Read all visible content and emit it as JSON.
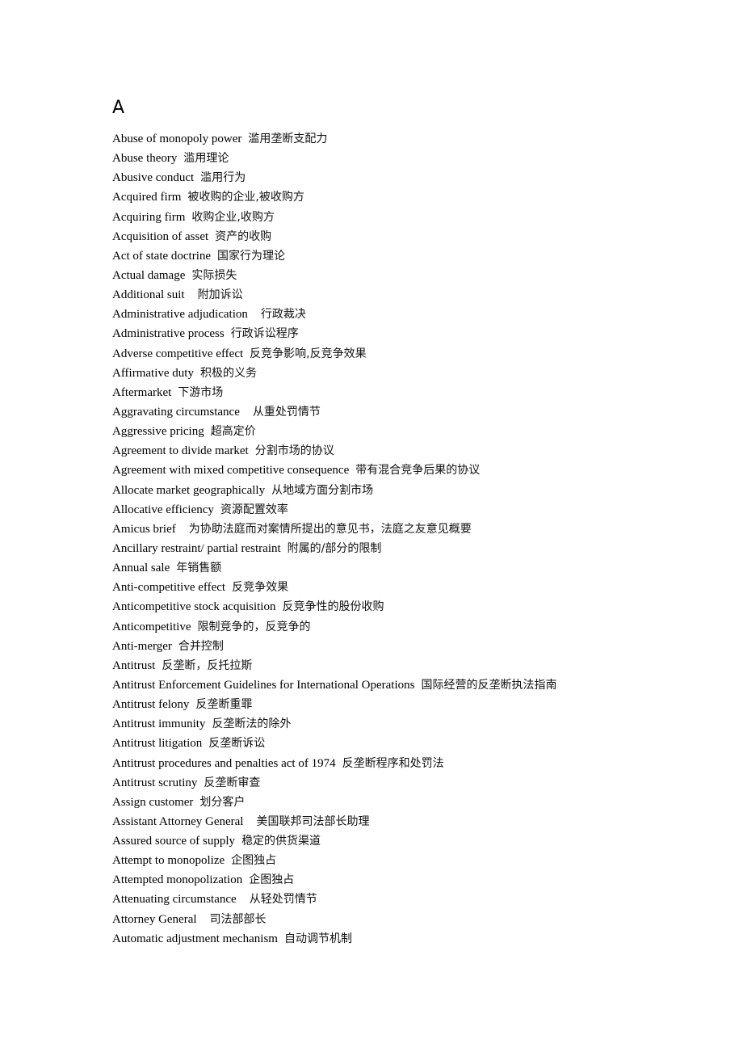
{
  "section_letter": "A",
  "entries": [
    {
      "term": "Abuse of monopoly power",
      "translation": "滥用垄断支配力"
    },
    {
      "term": "Abuse theory",
      "translation": "滥用理论"
    },
    {
      "term": "Abusive conduct",
      "translation": "滥用行为"
    },
    {
      "term": "Acquired firm",
      "translation": "被收购的企业,被收购方"
    },
    {
      "term": "Acquiring firm",
      "translation": "收购企业,收购方"
    },
    {
      "term": "Acquisition of asset",
      "translation": "资产的收购"
    },
    {
      "term": "Act of state doctrine",
      "translation": "国家行为理论"
    },
    {
      "term": "Actual damage",
      "translation": "实际损失"
    },
    {
      "term": "Additional suit",
      "translation": "附加诉讼",
      "wide": true
    },
    {
      "term": "Administrative adjudication",
      "translation": "行政裁决",
      "wide": true
    },
    {
      "term": "Administrative process",
      "translation": "行政诉讼程序"
    },
    {
      "term": "Adverse competitive effect",
      "translation": "反竞争影响,反竞争效果"
    },
    {
      "term": "Affirmative duty",
      "translation": "积极的义务"
    },
    {
      "term": "Aftermarket",
      "translation": "下游市场"
    },
    {
      "term": "Aggravating circumstance",
      "translation": "从重处罚情节",
      "wide": true
    },
    {
      "term": "Aggressive pricing",
      "translation": "超高定价"
    },
    {
      "term": "Agreement to divide market",
      "translation": "分割市场的协议"
    },
    {
      "term": "Agreement with mixed competitive consequence",
      "translation": "带有混合竞争后果的协议"
    },
    {
      "term": "Allocate market geographically",
      "translation": "从地域方面分割市场"
    },
    {
      "term": "Allocative efficiency",
      "translation": "资源配置效率"
    },
    {
      "term": "Amicus brief",
      "translation": "为协助法庭而对案情所提出的意见书，法庭之友意见概要",
      "wide": true
    },
    {
      "term": "Ancillary restraint/ partial restraint",
      "translation": "附属的/部分的限制"
    },
    {
      "term": "Annual sale",
      "translation": "年销售额"
    },
    {
      "term": "Anti-competitive effect",
      "translation": "反竞争效果"
    },
    {
      "term": "Anticompetitive stock acquisition",
      "translation": "反竞争性的股份收购"
    },
    {
      "term": "Anticompetitive",
      "translation": "限制竞争的，反竞争的"
    },
    {
      "term": "Anti-merger",
      "translation": "合并控制"
    },
    {
      "term": "Antitrust",
      "translation": "反垄断，反托拉斯"
    },
    {
      "term": "Antitrust Enforcement Guidelines for International Operations",
      "translation": "国际经营的反垄断执法指南"
    },
    {
      "term": "Antitrust felony",
      "translation": "反垄断重罪"
    },
    {
      "term": "Antitrust immunity",
      "translation": "反垄断法的除外"
    },
    {
      "term": "Antitrust litigation",
      "translation": "反垄断诉讼"
    },
    {
      "term": "Antitrust procedures and penalties act of 1974",
      "translation": "反垄断程序和处罚法"
    },
    {
      "term": "Antitrust scrutiny",
      "translation": "反垄断审查"
    },
    {
      "term": "Assign customer",
      "translation": "划分客户"
    },
    {
      "term": "Assistant Attorney General",
      "translation": "美国联邦司法部长助理",
      "wide": true
    },
    {
      "term": "Assured source of supply",
      "translation": "稳定的供货渠道"
    },
    {
      "term": "Attempt to monopolize",
      "translation": "企图独占"
    },
    {
      "term": "Attempted monopolization",
      "translation": "企图独占"
    },
    {
      "term": "Attenuating circumstance",
      "translation": "从轻处罚情节",
      "wide": true
    },
    {
      "term": "Attorney General",
      "translation": "司法部部长",
      "wide": true
    },
    {
      "term": "Automatic adjustment mechanism",
      "translation": "自动调节机制"
    }
  ]
}
